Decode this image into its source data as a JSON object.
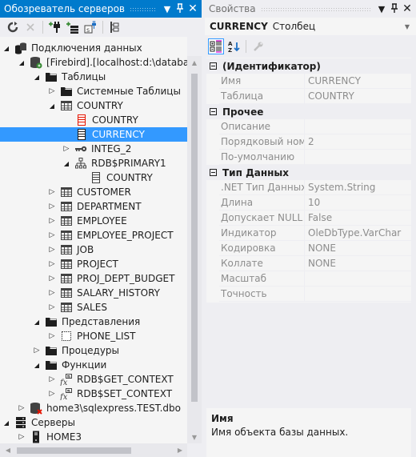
{
  "server_explorer": {
    "title": "Обозреватель серверов",
    "toolbar": [
      {
        "icon": "refresh-icon",
        "tooltip": ""
      },
      {
        "icon": "stop-icon",
        "tooltip": ""
      },
      {
        "icon": "connect-to-database-icon",
        "tooltip": ""
      },
      {
        "icon": "connect-to-server-icon",
        "tooltip": ""
      },
      {
        "icon": "connect-to-sharepoint-icon",
        "tooltip": ""
      },
      {
        "icon": "show-hierarchy-icon",
        "tooltip": ""
      }
    ],
    "tree": [
      {
        "label": "Подключения данных",
        "level": 0,
        "expander": "expanded",
        "icon": "data-connections-icon"
      },
      {
        "label": "[Firebird].[localhost:d:\\database",
        "level": 1,
        "expander": "expanded",
        "icon": "database-connected-icon"
      },
      {
        "label": "Таблицы",
        "level": 2,
        "expander": "expanded",
        "icon": "folder-icon"
      },
      {
        "label": "Системные Таблицы",
        "level": 3,
        "expander": "collapsed",
        "icon": "folder-icon"
      },
      {
        "label": "COUNTRY",
        "level": 3,
        "expander": "expanded",
        "icon": "table-icon"
      },
      {
        "label": "COUNTRY",
        "level": 4,
        "expander": "none",
        "icon": "primary-key-column-icon"
      },
      {
        "label": "CURRENCY",
        "level": 4,
        "expander": "none",
        "icon": "column-icon",
        "selected": true
      },
      {
        "label": "INTEG_2",
        "level": 4,
        "expander": "collapsed",
        "icon": "foreign-key-icon",
        "offset": -1
      },
      {
        "label": "RDB$PRIMARY1",
        "level": 4,
        "expander": "expanded",
        "icon": "index-icon",
        "offset": -1
      },
      {
        "label": "COUNTRY",
        "level": 5,
        "expander": "none",
        "icon": "column-icon",
        "offset": -1
      },
      {
        "label": "CUSTOMER",
        "level": 3,
        "expander": "collapsed",
        "icon": "table-icon"
      },
      {
        "label": "DEPARTMENT",
        "level": 3,
        "expander": "collapsed",
        "icon": "table-icon"
      },
      {
        "label": "EMPLOYEE",
        "level": 3,
        "expander": "collapsed",
        "icon": "table-icon"
      },
      {
        "label": "EMPLOYEE_PROJECT",
        "level": 3,
        "expander": "collapsed",
        "icon": "table-icon"
      },
      {
        "label": "JOB",
        "level": 3,
        "expander": "collapsed",
        "icon": "table-icon"
      },
      {
        "label": "PROJECT",
        "level": 3,
        "expander": "collapsed",
        "icon": "table-icon"
      },
      {
        "label": "PROJ_DEPT_BUDGET",
        "level": 3,
        "expander": "collapsed",
        "icon": "table-icon"
      },
      {
        "label": "SALARY_HISTORY",
        "level": 3,
        "expander": "collapsed",
        "icon": "table-icon"
      },
      {
        "label": "SALES",
        "level": 3,
        "expander": "collapsed",
        "icon": "table-icon"
      },
      {
        "label": "Представления",
        "level": 2,
        "expander": "expanded",
        "icon": "folder-icon"
      },
      {
        "label": "PHONE_LIST",
        "level": 3,
        "expander": "collapsed",
        "icon": "view-icon"
      },
      {
        "label": "Процедуры",
        "level": 2,
        "expander": "collapsed",
        "icon": "folder-icon"
      },
      {
        "label": "Функции",
        "level": 2,
        "expander": "expanded",
        "icon": "folder-icon"
      },
      {
        "label": "RDB$GET_CONTEXT",
        "level": 3,
        "expander": "collapsed",
        "icon": "function-icon"
      },
      {
        "label": "RDB$SET_CONTEXT",
        "level": 3,
        "expander": "collapsed",
        "icon": "function-icon"
      },
      {
        "label": "home3\\sqlexpress.TEST.dbo",
        "level": 1,
        "expander": "collapsed",
        "icon": "database-disconnected-icon"
      },
      {
        "label": "Серверы",
        "level": 0,
        "expander": "expanded",
        "icon": "servers-icon"
      },
      {
        "label": "HOME3",
        "level": 1,
        "expander": "collapsed",
        "icon": "server-icon"
      }
    ]
  },
  "properties": {
    "title": "Свойства",
    "object_name": "CURRENCY",
    "object_type": "Столбец",
    "categories": [
      {
        "name": "(Идентификатор)",
        "props": [
          {
            "name": "Имя",
            "value": "CURRENCY"
          },
          {
            "name": "Таблица",
            "value": "COUNTRY"
          }
        ]
      },
      {
        "name": "Прочее",
        "props": [
          {
            "name": "Описание",
            "value": ""
          },
          {
            "name": "Порядковый номер",
            "value": "2"
          },
          {
            "name": "По-умолчанию",
            "value": ""
          }
        ]
      },
      {
        "name": "Тип Данных",
        "props": [
          {
            "name": ".NET Тип Данных",
            "value": "System.String"
          },
          {
            "name": "Длина",
            "value": "10"
          },
          {
            "name": "Допускает NULL Значения",
            "value": "False"
          },
          {
            "name": "Индикатор",
            "value": "OleDbType.VarChar"
          },
          {
            "name": "Кодировка",
            "value": "NONE"
          },
          {
            "name": "Коллате",
            "value": "NONE"
          },
          {
            "name": "Масштаб",
            "value": ""
          },
          {
            "name": "Точность",
            "value": ""
          }
        ]
      }
    ],
    "description": {
      "title": "Имя",
      "text": "Имя объекта базы данных."
    }
  }
}
